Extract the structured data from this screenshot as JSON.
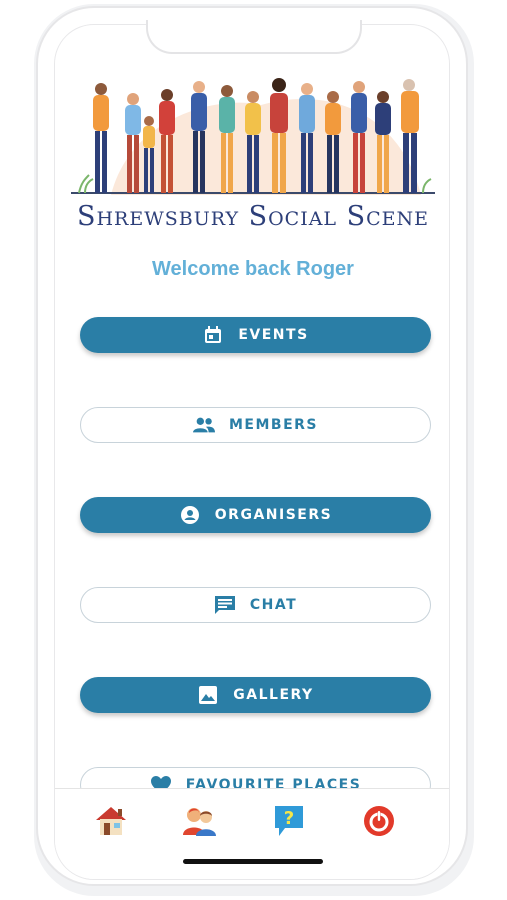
{
  "app": {
    "title": "Shrewsbury Social Scene",
    "welcome": "Welcome back Roger"
  },
  "menu": [
    {
      "label": "EVENTS",
      "icon": "calendar-icon",
      "style": "filled"
    },
    {
      "label": "MEMBERS",
      "icon": "people-icon",
      "style": "outline"
    },
    {
      "label": "ORGANISERS",
      "icon": "person-pin-icon",
      "style": "filled"
    },
    {
      "label": "CHAT",
      "icon": "chat-icon",
      "style": "outline"
    },
    {
      "label": "GALLERY",
      "icon": "image-icon",
      "style": "filled"
    },
    {
      "label": "FAVOURITE PLACES",
      "icon": "heart-icon",
      "style": "outline"
    }
  ],
  "bottom_nav": [
    {
      "icon": "home-icon"
    },
    {
      "icon": "members-icon"
    },
    {
      "icon": "help-icon"
    },
    {
      "icon": "power-icon"
    }
  ],
  "colors": {
    "primary": "#2a7ea6",
    "title": "#2d3f79",
    "welcome": "#63b0d8"
  }
}
